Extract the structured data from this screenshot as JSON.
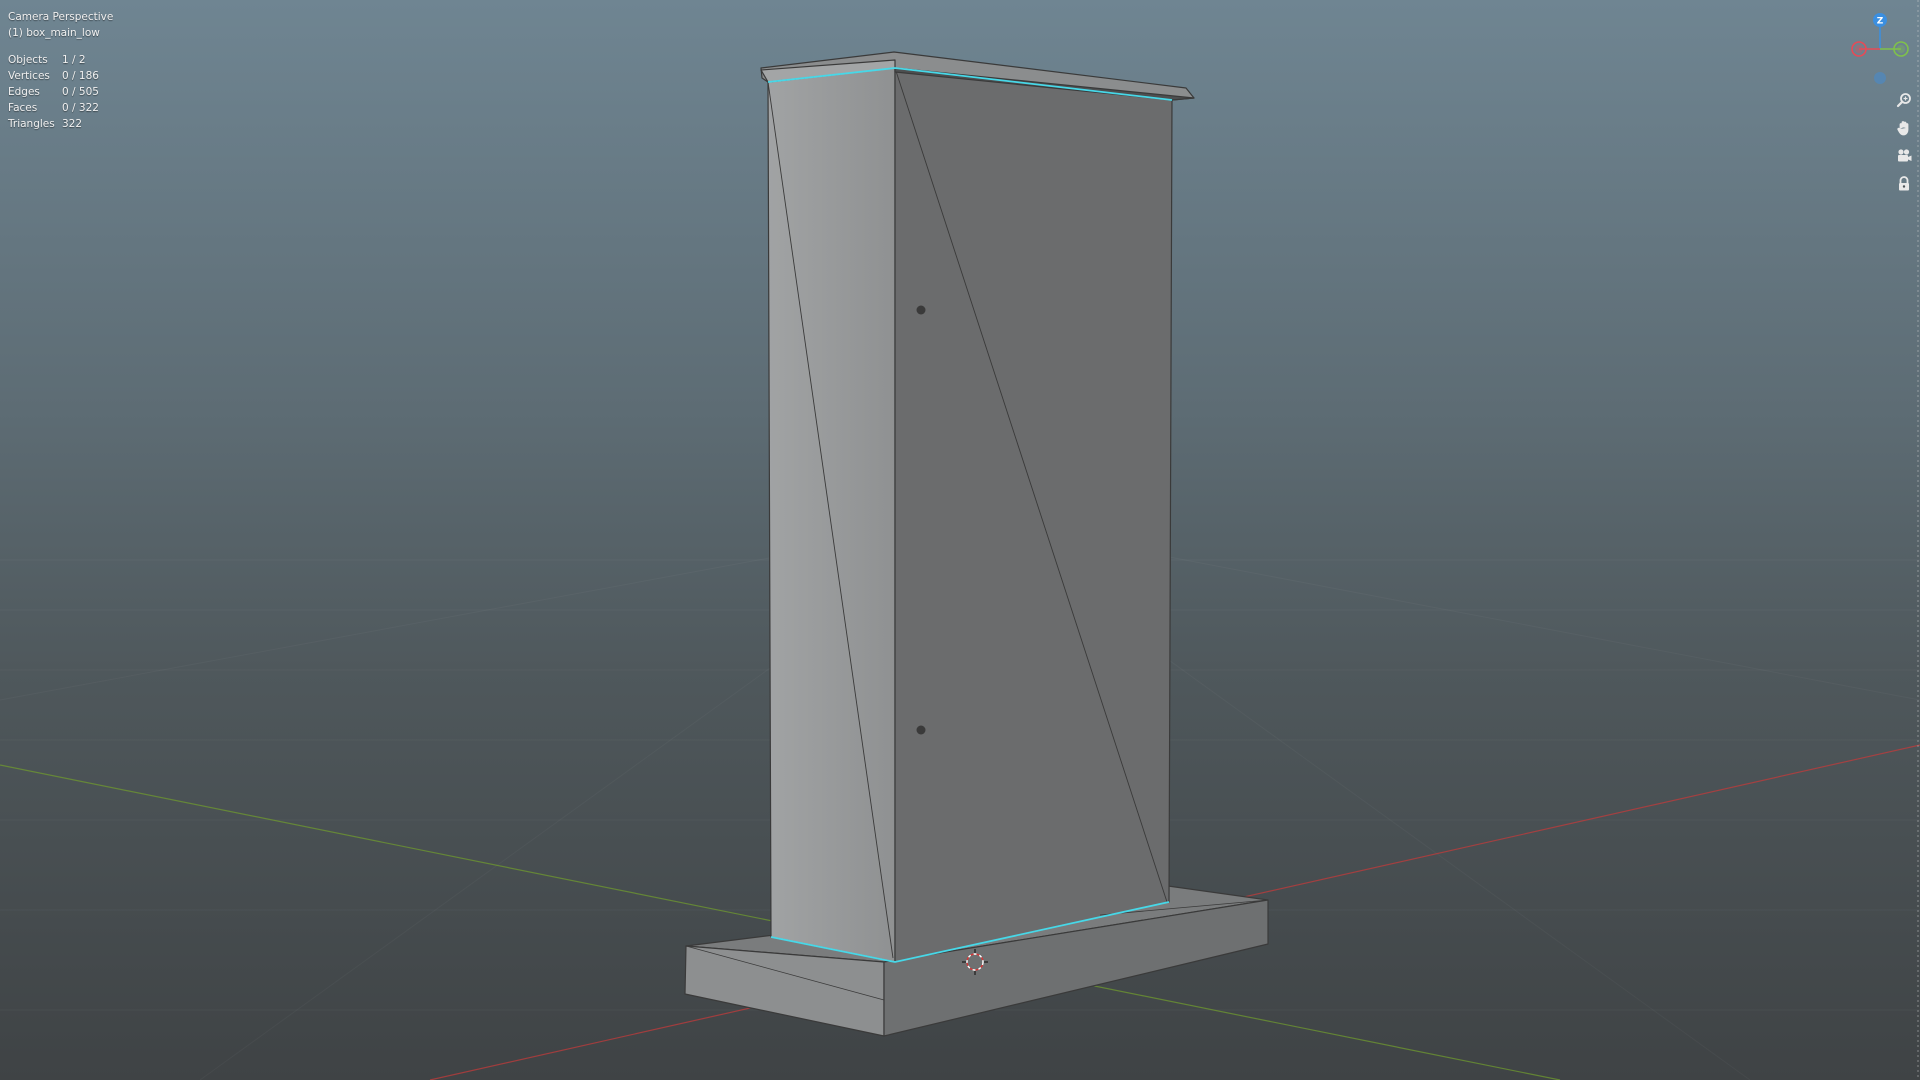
{
  "viewport": {
    "view_name": "Camera Perspective",
    "active_object": "(1) box_main_low"
  },
  "stats": [
    {
      "label": "Objects",
      "value": "1 / 2"
    },
    {
      "label": "Vertices",
      "value": "0 / 186"
    },
    {
      "label": "Edges",
      "value": "0 / 505"
    },
    {
      "label": "Faces",
      "value": "0 / 322"
    },
    {
      "label": "Triangles",
      "value": "322"
    }
  ],
  "gizmo": {
    "z_label": "Z",
    "colors": {
      "x": "#e84a56",
      "y": "#7fc14a",
      "z": "#3b8fe0"
    }
  },
  "nav_icons": [
    "zoom-icon",
    "hand-pan-icon",
    "camera-icon",
    "lock-icon"
  ],
  "colors": {
    "selected_edge": "#47d8e8",
    "x_axis_line": "#c23b3b",
    "y_axis_line": "#6f9a2f"
  }
}
